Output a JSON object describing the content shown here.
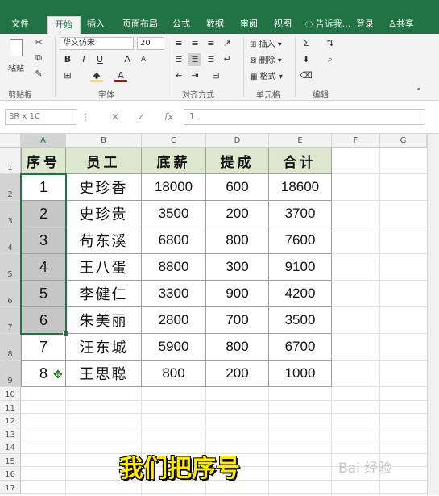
{
  "ribbon": {
    "tabs": [
      "文件",
      "开始",
      "插入",
      "页面布局",
      "公式",
      "数据",
      "审阅",
      "视图"
    ],
    "active_tab": "开始",
    "tell_me": "告诉我...",
    "login": "登录",
    "share": "共享",
    "font_name": "华文仿宋",
    "font_size": "20",
    "paste_label": "粘贴",
    "groups": [
      "剪贴板",
      "字体",
      "对齐方式",
      "单元格",
      "编辑"
    ],
    "cells_buttons": [
      "插入",
      "删除",
      "格式"
    ]
  },
  "formula_bar": {
    "name_box": "8R x 1C",
    "value": "1"
  },
  "sheet": {
    "columns": [
      "A",
      "B",
      "C",
      "D",
      "E",
      "F",
      "G"
    ],
    "rows": [
      "1",
      "2",
      "3",
      "4",
      "5",
      "6",
      "7",
      "8",
      "9",
      "10",
      "11",
      "12",
      "13",
      "14",
      "15",
      "16",
      "17"
    ],
    "headers": [
      "序号",
      "员工",
      "底薪",
      "提成",
      "合计"
    ],
    "data": [
      [
        "1",
        "史珍香",
        "18000",
        "600",
        "18600"
      ],
      [
        "2",
        "史珍贵",
        "3500",
        "200",
        "3700"
      ],
      [
        "3",
        "苟东溪",
        "6800",
        "800",
        "7600"
      ],
      [
        "4",
        "王八蛋",
        "8800",
        "300",
        "9100"
      ],
      [
        "5",
        "李健仁",
        "3300",
        "900",
        "4200"
      ],
      [
        "6",
        "朱美丽",
        "2800",
        "700",
        "3500"
      ],
      [
        "7",
        "汪东城",
        "5900",
        "800",
        "6700"
      ],
      [
        "8",
        "王思聪",
        "800",
        "200",
        "1000"
      ]
    ]
  },
  "caption": "我们把序号",
  "watermark": "Bai 经验",
  "colors": {
    "excel_green": "#217346",
    "header_fill": "#dbe8cf",
    "selection": "#c6c6c6",
    "caption": "#ffeb00"
  }
}
